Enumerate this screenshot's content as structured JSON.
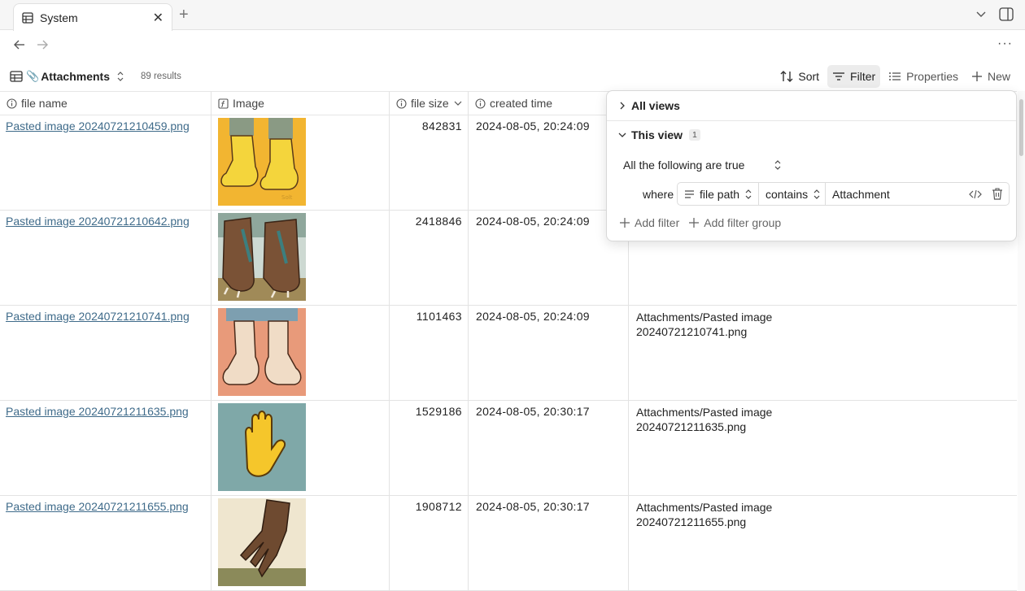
{
  "tabs": [
    {
      "title": "System"
    }
  ],
  "toolbar": {
    "view_name": "Attachments",
    "results": "89 results",
    "sort_label": "Sort",
    "filter_label": "Filter",
    "properties_label": "Properties",
    "new_label": "New"
  },
  "columns": [
    {
      "label": "file name",
      "icon": "info-icon"
    },
    {
      "label": "Image",
      "icon": "formula-icon"
    },
    {
      "label": "file size",
      "icon": "info-icon"
    },
    {
      "label": "created time",
      "icon": "info-icon"
    }
  ],
  "rows": [
    {
      "name": "Pasted image 20240721210459.png",
      "image": "yellow-feet-cartoon",
      "size": "842831",
      "time": "2024-08-05, 20:24:09",
      "path": "",
      "path2": ""
    },
    {
      "name": "Pasted image 20240721210642.png",
      "image": "dinosaur-feet-illustration",
      "size": "2418846",
      "time": "2024-08-05, 20:24:09",
      "path": "",
      "path2": ""
    },
    {
      "name": "Pasted image 20240721210741.png",
      "image": "bare-feet-cartoon",
      "size": "1101463",
      "time": "2024-08-05, 20:24:09",
      "path": "Attachments/Pasted image",
      "path2": "20240721210741.png"
    },
    {
      "name": "Pasted image 20240721211635.png",
      "image": "yellow-hand-emoji",
      "size": "1529186",
      "time": "2024-08-05, 20:30:17",
      "path": "Attachments/Pasted image",
      "path2": "20240721211635.png"
    },
    {
      "name": "Pasted image 20240721211655.png",
      "image": "claw-foot-illustration",
      "size": "1908712",
      "time": "2024-08-05, 20:30:17",
      "path": "Attachments/Pasted image",
      "path2": "20240721211655.png"
    }
  ],
  "filter_popover": {
    "all_views": "All views",
    "this_view": "This view",
    "this_view_count": "1",
    "conjunction": "All the following are true",
    "where": "where",
    "property": "file path",
    "operator": "contains",
    "value": "Attachment",
    "add_filter": "Add filter",
    "add_filter_group": "Add filter group"
  }
}
